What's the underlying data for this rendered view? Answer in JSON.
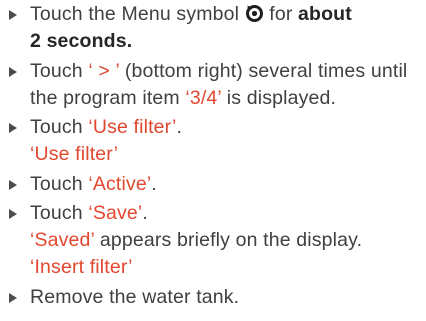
{
  "colors": {
    "body_text": "#404040",
    "display_text": "#e2472f",
    "emphasis_text": "#262626",
    "bullet": "#4d4d4d"
  },
  "icons": {
    "bullet": "triangle-right-icon",
    "menu": "menu-symbol-icon"
  },
  "steps": [
    {
      "text_1": "Touch the Menu symbol",
      "text_2": "for",
      "emphasis_1": "about",
      "emphasis_2": "2 seconds."
    },
    {
      "text_1": "Touch",
      "display_1": "‘ > ’",
      "text_2": "(bottom right) several times until",
      "text_3": "the program item",
      "display_2": "‘3/4’",
      "text_4": "is displayed."
    },
    {
      "text_1": "Touch",
      "display_1": "‘Use filter’",
      "text_2": ".",
      "display_result": "‘Use filter’"
    },
    {
      "text_1": "Touch",
      "display_1": "‘Active’",
      "text_2": "."
    },
    {
      "text_1": "Touch",
      "display_1": "‘Save’",
      "text_2": ".",
      "display_result": "‘Saved’",
      "text_3": "appears briefly on the display.",
      "display_result_2": "‘Insert filter’"
    },
    {
      "text_1": "Remove the water tank."
    }
  ]
}
